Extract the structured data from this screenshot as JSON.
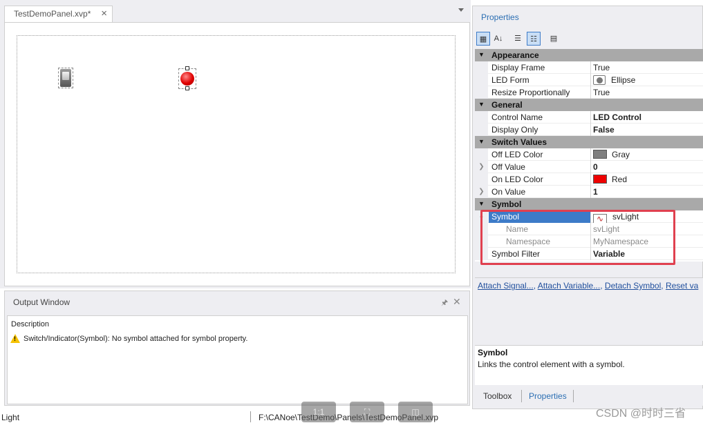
{
  "editor": {
    "tab_label": "TestDemoPanel.xvp*",
    "tab_close": "×"
  },
  "output_window": {
    "title": "Output Window",
    "pin_icon": "pin-icon",
    "close": "✕",
    "column_header": "Description",
    "message": "Switch/Indicator(Symbol): No symbol attached for symbol property."
  },
  "status_bar": {
    "left_text": "Light",
    "path": "F:\\CANoe\\TestDemo\\Panels\\TestDemoPanel.xvp"
  },
  "properties": {
    "title": "Properties",
    "toolbar": {
      "categorized": "categorized-icon",
      "alphabetical": "alphabetical-icon",
      "properties_view": "properties-icon",
      "events_view": "events-icon",
      "property_pages": "property-pages-icon"
    },
    "categories": [
      {
        "label": "Appearance",
        "rows": [
          {
            "name": "Display Frame",
            "value": "True"
          },
          {
            "name": "LED Form",
            "value": "Ellipse"
          },
          {
            "name": "Resize Proportionally",
            "value": "True"
          }
        ]
      },
      {
        "label": "General",
        "rows": [
          {
            "name": "Control Name",
            "value": "LED Control"
          },
          {
            "name": "Display Only",
            "value": "False"
          }
        ]
      },
      {
        "label": "Switch Values",
        "rows": [
          {
            "name": "Off LED Color",
            "value": "Gray",
            "color": "#7f7f7f"
          },
          {
            "name": "Off Value",
            "value": "0"
          },
          {
            "name": "On LED Color",
            "value": "Red",
            "color": "#ee0000"
          },
          {
            "name": "On Value",
            "value": "1"
          }
        ]
      },
      {
        "label": "Symbol",
        "rows": [
          {
            "name": "Symbol",
            "value": "svLight"
          },
          {
            "name": "Name",
            "value": "svLight"
          },
          {
            "name": "Namespace",
            "value": "MyNamespace"
          },
          {
            "name": "Symbol Filter",
            "value": "Variable"
          }
        ]
      }
    ],
    "actions": {
      "attach_signal": "Attach Signal...",
      "attach_variable": "Attach Variable...",
      "detach_symbol": "Detach Symbol",
      "reset_values": "Reset va"
    },
    "help": {
      "title": "Symbol",
      "text": "Links the control element with a symbol."
    },
    "tabs": {
      "toolbox": "Toolbox",
      "properties": "Properties"
    }
  },
  "watermark": "CSDN @时时三省",
  "colors": {
    "accent": "#2c6fb3",
    "highlight_box": "#e0404f",
    "selected_row": "#3d7bc8",
    "category_band": "#a9a9a9"
  }
}
